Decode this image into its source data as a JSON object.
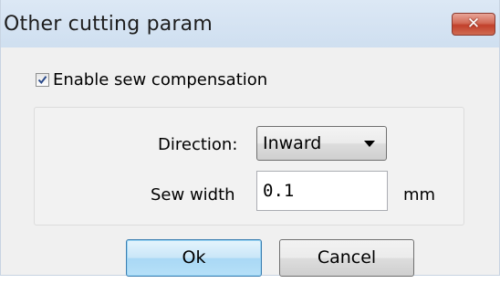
{
  "window": {
    "title": "Other cutting param",
    "close_icon": "close-icon"
  },
  "checkbox": {
    "label": "Enable sew compensation",
    "checked": true
  },
  "direction": {
    "label": "Direction:",
    "selected": "Inward"
  },
  "sew_width": {
    "label": "Sew width",
    "value": "0.1",
    "unit": "mm"
  },
  "buttons": {
    "ok": "Ok",
    "cancel": "Cancel"
  },
  "colors": {
    "titlebar": "#d6e4f3",
    "close_button": "#c94b37",
    "ok_button_border": "#3c7fb1",
    "dialog_background": "#f0f0f0"
  }
}
